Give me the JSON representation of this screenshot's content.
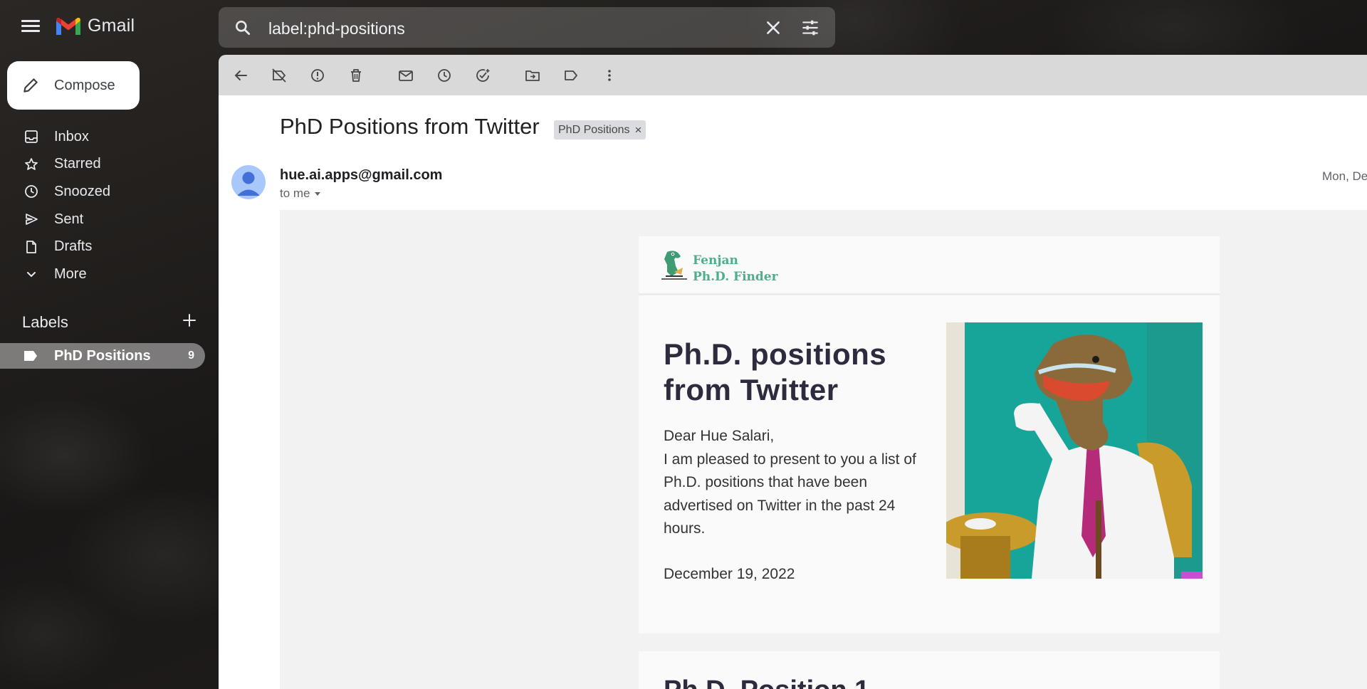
{
  "app": {
    "name": "Gmail"
  },
  "search": {
    "value": "label:phd-positions"
  },
  "sidebar": {
    "compose_label": "Compose",
    "items": [
      {
        "label": "Inbox",
        "icon": "inbox-icon"
      },
      {
        "label": "Starred",
        "icon": "star-icon"
      },
      {
        "label": "Snoozed",
        "icon": "clock-icon"
      },
      {
        "label": "Sent",
        "icon": "send-icon"
      },
      {
        "label": "Drafts",
        "icon": "draft-icon"
      },
      {
        "label": "More",
        "icon": "chevron-down-icon"
      }
    ],
    "labels_heading": "Labels",
    "labels": [
      {
        "name": "PhD Positions",
        "count": "9"
      }
    ]
  },
  "email": {
    "subject": "PhD Positions from Twitter",
    "label_chip": "PhD Positions",
    "chip_close": "×",
    "sender": "hue.ai.apps@gmail.com",
    "to": "to me",
    "date": "Mon, De"
  },
  "newsletter": {
    "brand_line1": "Fenjan",
    "brand_line2": "Ph.D. Finder",
    "title": "Ph.D. positions from Twitter",
    "greeting": "Dear Hue Salari,",
    "intro": "I am pleased to present to you a list of Ph.D. positions that have been advertised on Twitter in the past 24 hours.",
    "date": "December 19, 2022",
    "next_heading": "Ph.D. Position 1"
  },
  "colors": {
    "brand_green": "#4caf8a",
    "gmail_red": "#ea4335",
    "gmail_blue": "#4285f4",
    "gmail_yellow": "#fbbc04",
    "gmail_green": "#34a853"
  }
}
